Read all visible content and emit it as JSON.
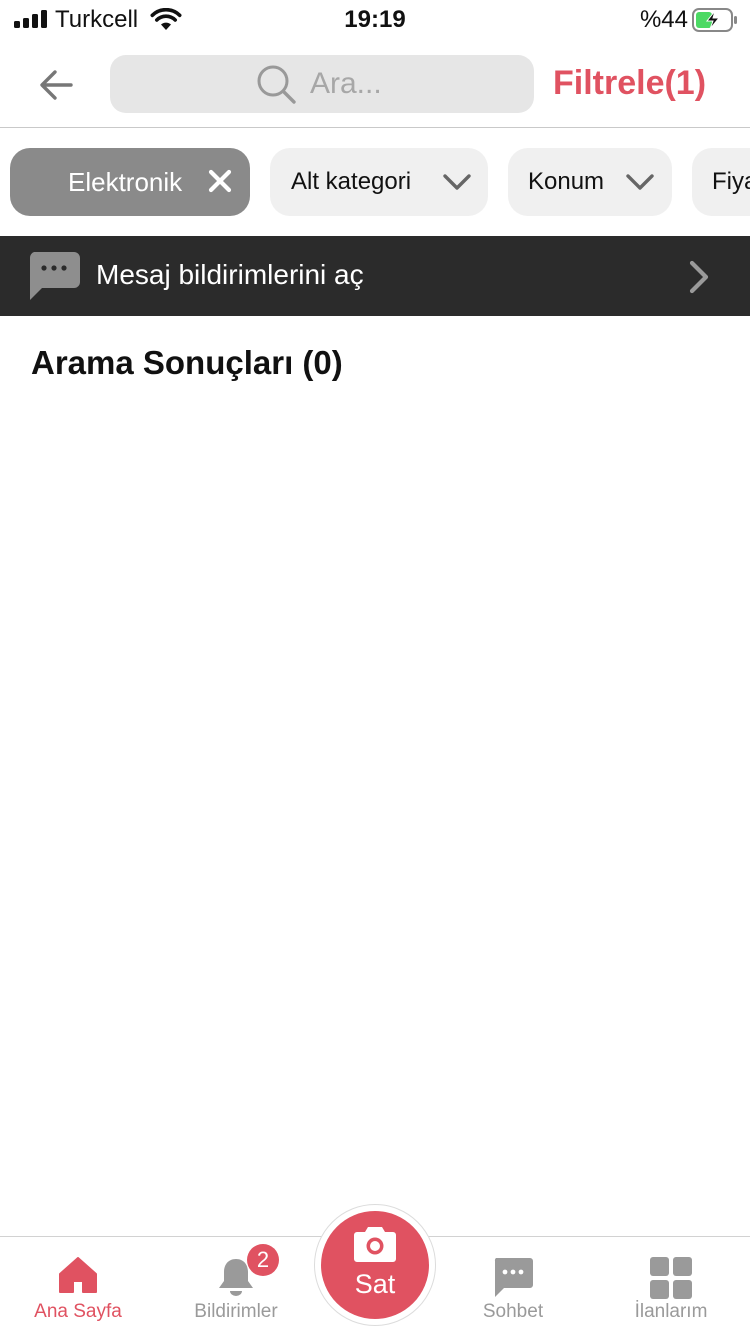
{
  "status": {
    "carrier": "Turkcell",
    "time": "19:19",
    "battery": "%44"
  },
  "nav": {
    "search_placeholder": "Ara...",
    "filter_label": "Filtrele(1)"
  },
  "chips": {
    "active": "Elektronik",
    "subcategory": "Alt kategori",
    "location": "Konum",
    "price": "Fiya"
  },
  "banner": {
    "text": "Mesaj bildirimlerini aç"
  },
  "results": {
    "title": "Arama Sonuçları (0)"
  },
  "tabs": {
    "home": "Ana Sayfa",
    "notifications": "Bildirimler",
    "notifications_badge": "2",
    "sell": "Sat",
    "chat": "Sohbet",
    "listings": "İlanlarım"
  },
  "colors": {
    "accent": "#e05261",
    "banner_bg": "#2b2b2b",
    "chip_active": "#8a8a8a",
    "chip_bg": "#f0f0f0"
  }
}
